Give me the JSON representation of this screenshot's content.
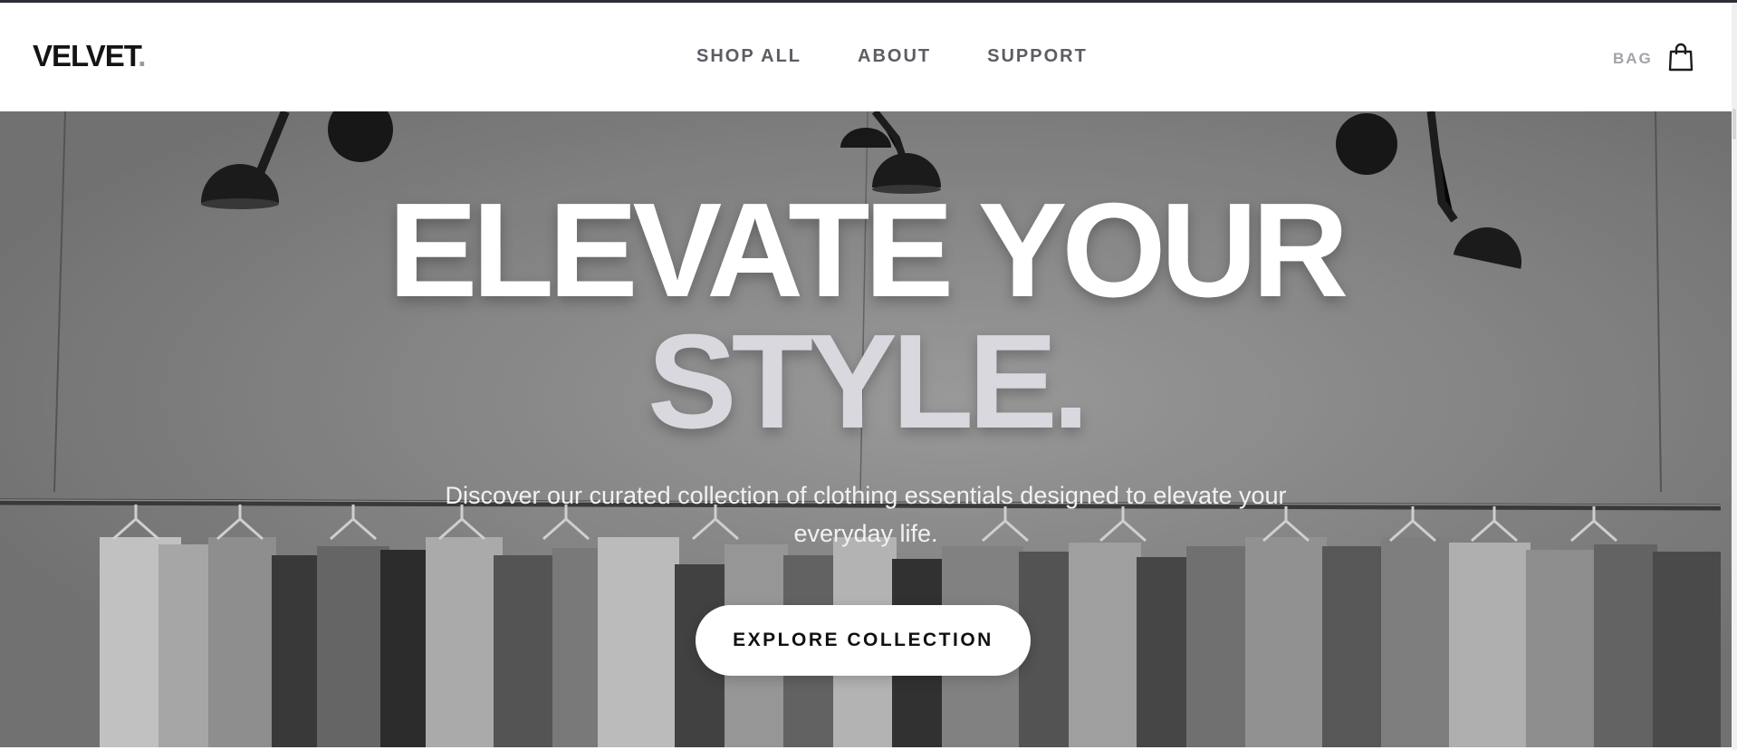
{
  "header": {
    "logo_text": "VELVET",
    "logo_dot": ".",
    "nav": [
      "SHOP ALL",
      "ABOUT",
      "SUPPORT"
    ],
    "bag_label": "BAG",
    "bag_icon": "shopping-bag-icon"
  },
  "hero": {
    "headline_line1": "ELEVATE YOUR",
    "headline_line2": "STYLE.",
    "subtitle": "Discover our curated collection of clothing essentials designed to elevate your everyday life.",
    "cta_label": "EXPLORE COLLECTION",
    "background": "grayscale photo of hanging clothes on a rail under black wall lamps"
  },
  "colors": {
    "brand_text": "#141414",
    "nav_text": "#5c5c64",
    "headline_primary": "#ffffff",
    "headline_secondary": "#d9d8df",
    "cta_background": "#ffffff"
  }
}
